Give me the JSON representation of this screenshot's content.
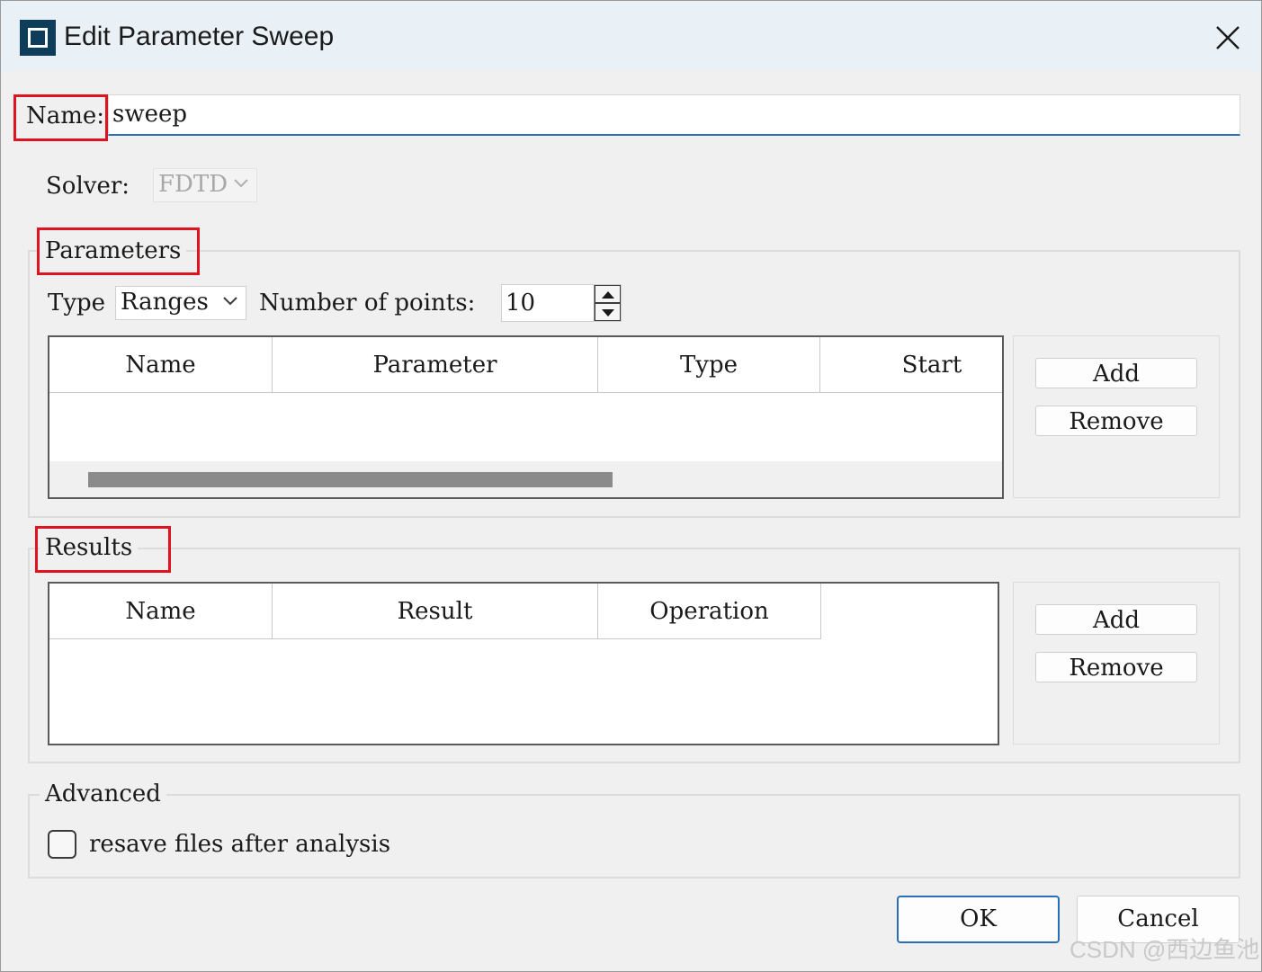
{
  "window": {
    "title": "Edit Parameter Sweep"
  },
  "name_field": {
    "label": "Name:",
    "value": "sweep"
  },
  "solver": {
    "label": "Solver:",
    "value": "FDTD"
  },
  "parameters": {
    "group_title": "Parameters",
    "type_label": "Type",
    "type_value": "Ranges",
    "points_label": "Number of points:",
    "points_value": "10",
    "columns": [
      "Name",
      "Parameter",
      "Type",
      "Start"
    ],
    "rows": [],
    "add_label": "Add",
    "remove_label": "Remove"
  },
  "results": {
    "group_title": "Results",
    "columns": [
      "Name",
      "Result",
      "Operation"
    ],
    "rows": [],
    "add_label": "Add",
    "remove_label": "Remove"
  },
  "advanced": {
    "group_title": "Advanced",
    "resave_label": "resave files after analysis",
    "resave_checked": false
  },
  "footer": {
    "ok_label": "OK",
    "cancel_label": "Cancel"
  },
  "watermark": "CSDN @西边鱼池",
  "colors": {
    "highlight": "#e0141e",
    "focus_border": "#2a6fb5",
    "app_icon": "#0e3d5c",
    "titlebar": "#eaf1f6"
  }
}
